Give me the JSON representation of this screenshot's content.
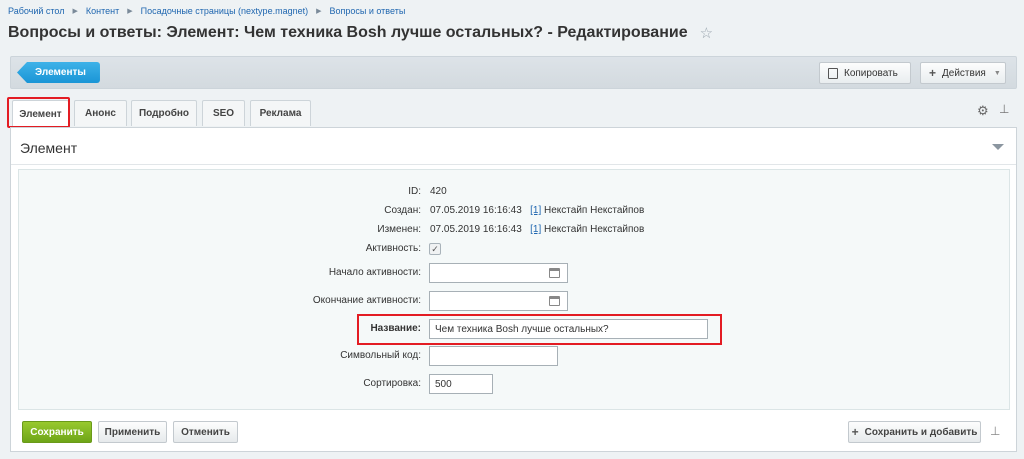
{
  "breadcrumb": [
    "Рабочий стол",
    "Контент",
    "Посадочные страницы (nextype.magnet)",
    "Вопросы и ответы"
  ],
  "page": {
    "title": "Вопросы и ответы: Элемент: Чем техника Bosh лучше остальных? - Редактирование",
    "star_icon": "☆"
  },
  "toolbar": {
    "elements_label": "Элементы",
    "copy_label": "Копировать",
    "actions_label": "Действия"
  },
  "tabs": [
    {
      "label": "Элемент",
      "active": true
    },
    {
      "label": "Анонс",
      "active": false
    },
    {
      "label": "Подробно",
      "active": false
    },
    {
      "label": "SEO",
      "active": false
    },
    {
      "label": "Реклама",
      "active": false
    }
  ],
  "section": {
    "title": "Элемент"
  },
  "form": {
    "id_label": "ID:",
    "id_value": "420",
    "created_label": "Создан:",
    "created_date": "07.05.2019 16:16:43",
    "created_user_id": "[1]",
    "created_user": "Некстайп Некстайпов",
    "modified_label": "Изменен:",
    "modified_date": "07.05.2019 16:16:43",
    "modified_user_id": "[1]",
    "modified_user": "Некстайп Некстайпов",
    "active_label": "Активность:",
    "active_checked": true,
    "active_from_label": "Начало активности:",
    "active_from_value": "",
    "active_to_label": "Окончание активности:",
    "active_to_value": "",
    "name_label": "Название:",
    "name_value": "Чем техника Bosh лучше остальных?",
    "code_label": "Символьный код:",
    "code_value": "",
    "sort_label": "Сортировка:",
    "sort_value": "500"
  },
  "footer": {
    "save_label": "Сохранить",
    "apply_label": "Применить",
    "cancel_label": "Отменить",
    "save_add_label": "Сохранить и добавить"
  },
  "colors": {
    "highlight": "#e31c23",
    "save_button": "#7db321",
    "elements_button": "#27a3e0"
  }
}
